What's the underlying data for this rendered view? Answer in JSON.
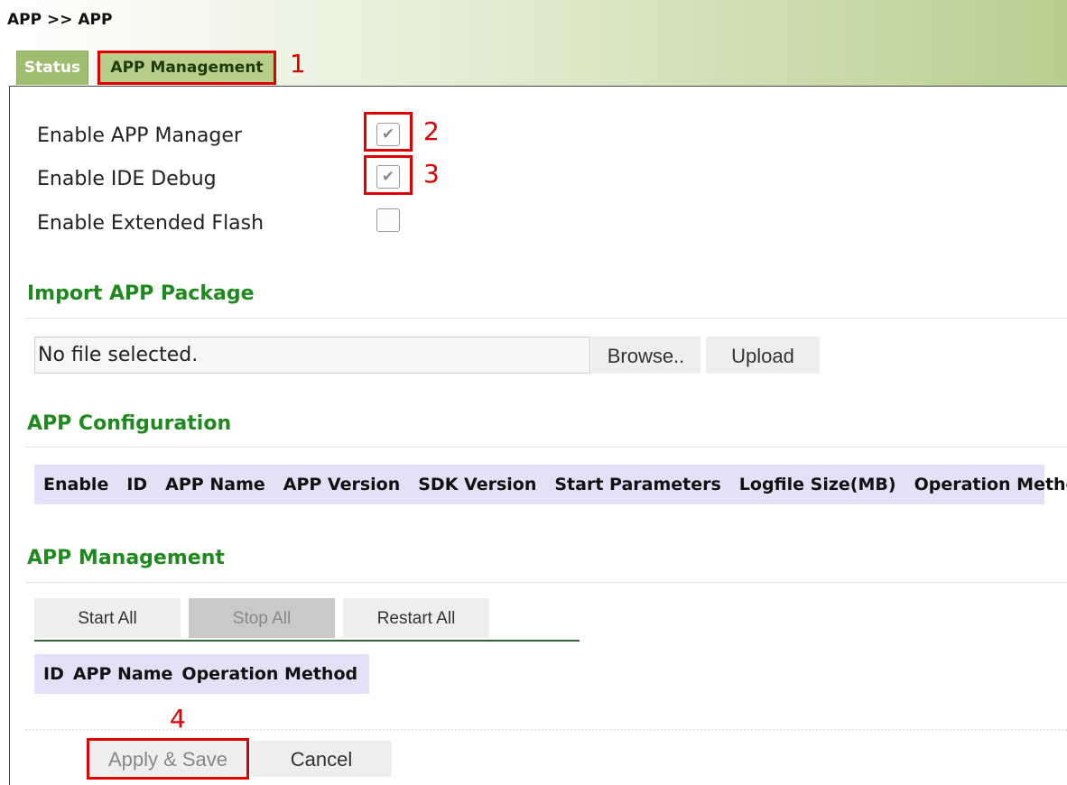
{
  "breadcrumb": "APP >> APP",
  "tabs": {
    "status": "Status",
    "app_management": "APP Management"
  },
  "settings": [
    {
      "label": "Enable APP Manager",
      "checked": true
    },
    {
      "label": "Enable IDE Debug",
      "checked": true
    },
    {
      "label": "Enable Extended Flash",
      "checked": false
    }
  ],
  "import": {
    "title": "Import APP Package",
    "file_value": "No file selected.",
    "browse_label": "Browse..",
    "upload_label": "Upload"
  },
  "config": {
    "title": "APP Configuration",
    "columns": [
      "Enable",
      "ID",
      "APP Name",
      "APP Version",
      "SDK Version",
      "Start Parameters",
      "Logfile Size(MB)",
      "Operation Method"
    ]
  },
  "management": {
    "title": "APP Management",
    "start_all": "Start All",
    "stop_all": "Stop All",
    "restart_all": "Restart All",
    "columns": [
      "ID",
      "APP Name",
      "Operation Method"
    ]
  },
  "footer": {
    "apply_label": "Apply & Save",
    "cancel_label": "Cancel"
  },
  "annotations": [
    "1",
    "2",
    "3",
    "4"
  ],
  "colors": {
    "accent_green": "#1e8a1e",
    "highlight_red": "#e00000",
    "table_header": "#e3e1f5"
  }
}
